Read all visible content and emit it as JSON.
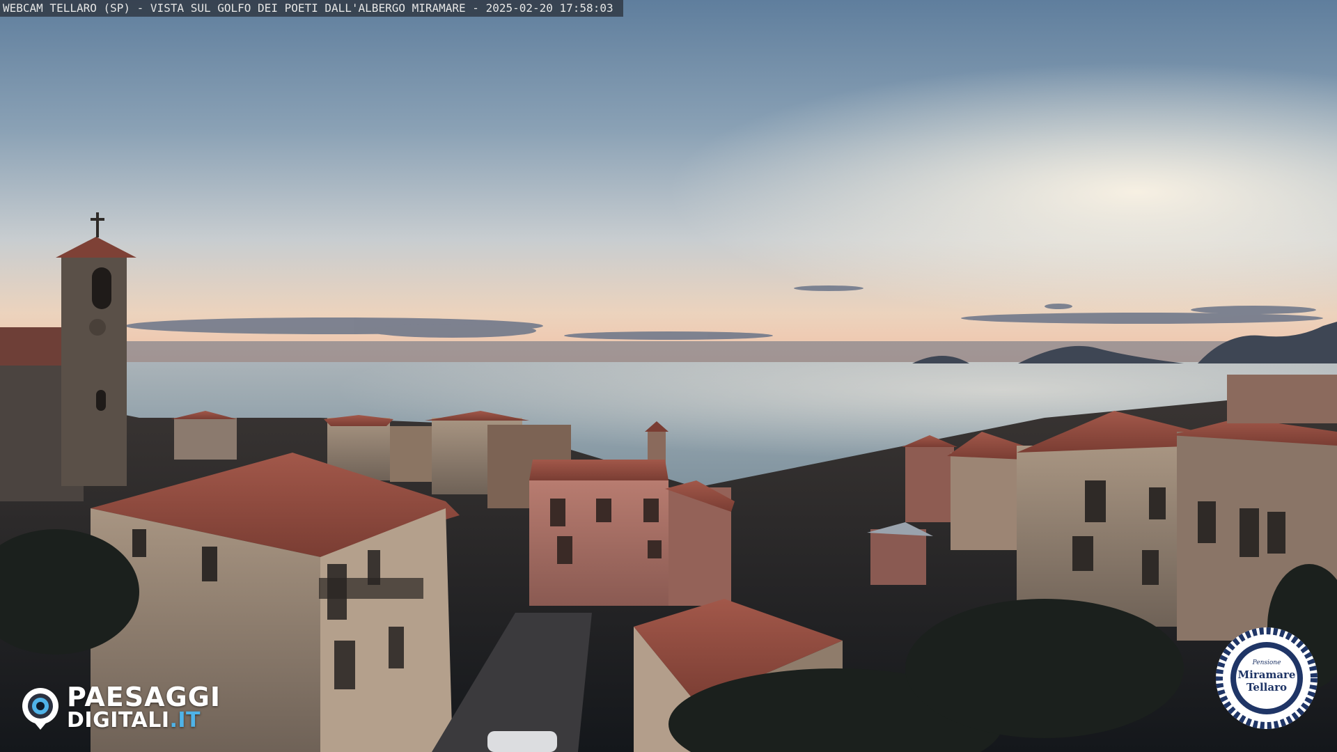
{
  "caption": {
    "text": "WEBCAM TELLARO (SP) - VISTA SUL GOLFO DEI POETI DALL'ALBERGO MIRAMARE - 2025-02-20 17:58:03"
  },
  "logo_paesaggi": {
    "line1": "PAESAGGI",
    "line2_main": "DIGITALI",
    "line2_suffix": ".IT",
    "accent_color": "#4fb3e8"
  },
  "badge_miramare": {
    "script_line": "Pensione",
    "name_line1": "Miramare",
    "name_line2": "Tellaro",
    "ring_color": "#1f3566"
  },
  "colors": {
    "sky_top": "#5e7d9c",
    "sky_horizon": "#f3c9a8",
    "sea": "#8ea2ad"
  }
}
